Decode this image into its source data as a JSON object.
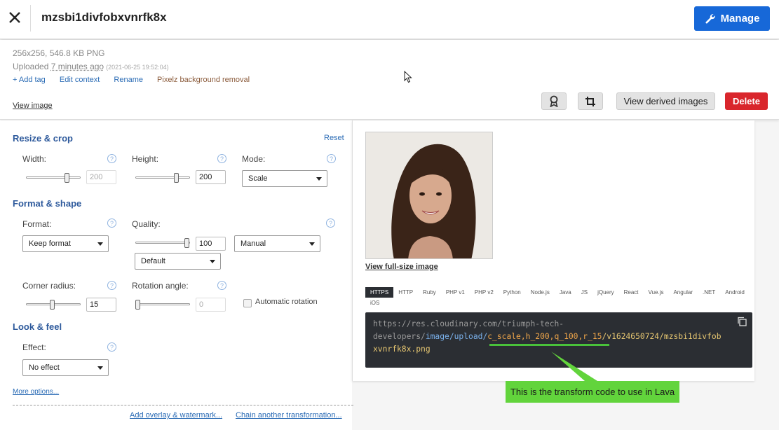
{
  "header": {
    "title": "mzsbi1divfobxvnrfk8x",
    "manage_label": "Manage"
  },
  "info": {
    "dimensions": "256x256, 546.8 KB PNG",
    "uploaded_prefix": "Uploaded ",
    "uploaded_ago": "7 minutes ago",
    "uploaded_stamp": "(2021-06-25 19:52:04)",
    "links": [
      "+ Add tag",
      "Edit context",
      "Rename",
      "Pixelz background removal"
    ],
    "view_image": "View image",
    "view_derived_label": "View derived images",
    "delete_label": "Delete"
  },
  "transform": {
    "resize_title": "Resize & crop",
    "reset": "Reset",
    "width_label": "Width:",
    "width_value": "200",
    "width_slider": 0.78,
    "height_label": "Height:",
    "height_value": "200",
    "height_slider": 0.78,
    "mode_label": "Mode:",
    "mode_value": "Scale",
    "format_title": "Format & shape",
    "format_label": "Format:",
    "format_value": "Keep format",
    "quality_label": "Quality:",
    "quality_value": "100",
    "quality_slider": 1.0,
    "quality_mode": "Manual",
    "quality_preset": "Default",
    "corner_label": "Corner radius:",
    "corner_value": "15",
    "corner_slider": 0.48,
    "rotation_label": "Rotation angle:",
    "rotation_value": "0",
    "rotation_slider": 0.0,
    "auto_rotation": "Automatic rotation",
    "look_title": "Look & feel",
    "effect_label": "Effect:",
    "effect_value": "No effect",
    "more_options": "More options...",
    "add_overlay": "Add overlay & watermark...",
    "chain": "Chain another transformation..."
  },
  "preview": {
    "full_size": "View full-size image",
    "tabs": [
      "HTTPS",
      "HTTP",
      "Ruby",
      "PHP v1",
      "PHP v2",
      "Python",
      "Node.js",
      "Java",
      "JS",
      "jQuery",
      "React",
      "Vue.js",
      "Angular",
      ".NET",
      "Android",
      "iOS"
    ],
    "active_tab": "HTTPS",
    "code_line1": "https://res.cloudinary.com/triumph-tech-",
    "code_line2_a": "developers/",
    "code_line2_path": "image/upload/",
    "code_line2_tx": "c_scale,h_200,q_100,r_15",
    "code_line2_b": "/v1624650724/mzsbi1divfob",
    "code_line3": "xvnrfk8x.png"
  },
  "annotation": {
    "callout_text": "This is the transform code to use in Lava",
    "accent": "#62d43c"
  },
  "colors": {
    "primary": "#1768d8",
    "danger": "#d9262c",
    "section": "#2e5a9c",
    "code_bg": "#2b2e33"
  }
}
